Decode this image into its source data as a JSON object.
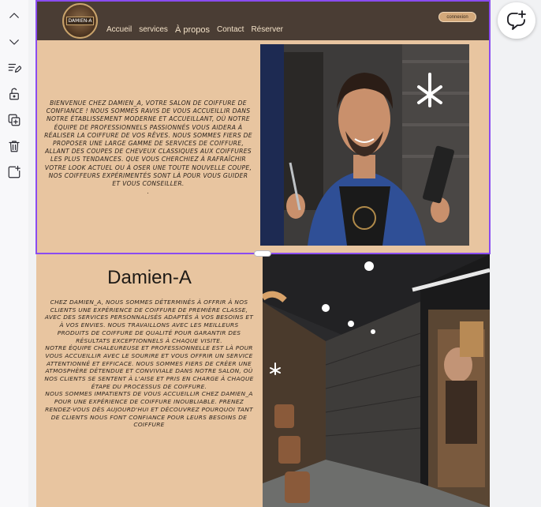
{
  "toolbar": {
    "items": [
      {
        "icon": "chevron-up-icon"
      },
      {
        "icon": "chevron-down-icon"
      },
      {
        "icon": "edit-text-icon"
      },
      {
        "icon": "lock-icon"
      },
      {
        "icon": "duplicate-icon"
      },
      {
        "icon": "trash-icon"
      },
      {
        "icon": "add-section-icon"
      }
    ]
  },
  "header": {
    "logo_text": "DAMIEN-A",
    "nav": [
      "Accueil",
      "services",
      "À propos",
      "Contact",
      "Réserver"
    ],
    "login_label": "connexion"
  },
  "section1": {
    "paragraph": "Bienvenue chez Damien_A, votre salon de coiffure de confiance ! Nous sommes ravis de vous accueillir dans notre établissement moderne et accueillant, où notre équipe de professionnels passionnés vous aidera à réaliser la coiffure de vos rêves. Nous sommes fiers de proposer une large gamme de services de coiffure, allant des coupes de cheveux classiques aux coiffures les plus tendances. Que vous cherchiez à rafraîchir votre look actuel ou à oser une toute nouvelle coupe, nos coiffeurs expérimentés sont là pour vous guider et vous conseiller.",
    "trailing_dot": ".",
    "photo_icon": "barber-portrait-photo"
  },
  "section2": {
    "title": "Damien-A",
    "paragraphs": [
      "Chez Damien_A, nous sommes déterminés à offrir à nos clients une expérience de coiffure de première classe, avec des services personnalisés adaptés à vos besoins et à vos envies. Nous travaillons avec les meilleurs produits de coiffure de qualité pour garantir des résultats exceptionnels à chaque visite.",
      "Notre équipe chaleureuse et professionnelle est là pour vous accueillir avec le sourire et vous offrir un service attentionné et efficace. Nous sommes fiers de créer une atmosphère détendue et conviviale dans notre salon, où nos clients se sentent à l'aise et pris en charge à chaque étape du processus de coiffure.",
      "Nous sommes impatients de vous accueillir chez Damien_A pour une expérience de coiffure inoubliable. Prenez rendez-vous dès aujourd'hui et découvrez pourquoi tant de clients nous font confiance pour leurs besoins de coiffure"
    ],
    "photo_icon": "salon-interior-photo"
  },
  "comment_button": {
    "icon": "add-comment-icon"
  },
  "colors": {
    "accent_selection": "#8a4cf0",
    "header_bg": "#4a3d34",
    "page_bg": "#e8c5a0"
  }
}
